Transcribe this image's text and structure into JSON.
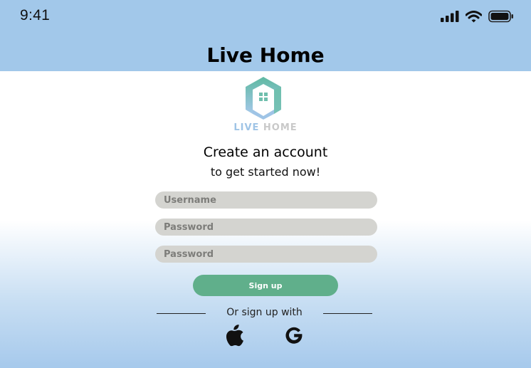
{
  "status_bar": {
    "time": "9:41"
  },
  "header": {
    "title": "Live Home"
  },
  "logo": {
    "text_live": "LIVE",
    "text_home": "HOME"
  },
  "form": {
    "heading": "Create an account",
    "subheading": "to get started now!",
    "username_placeholder": "Username",
    "password_placeholder": "Password",
    "confirm_password_placeholder": "Password",
    "signup_label": "Sign up",
    "alt_signup_text": "Or sign up with"
  },
  "social": {
    "apple_icon": "apple-icon",
    "google_icon": "google-icon"
  },
  "colors": {
    "header_bg": "#a2c8ea",
    "signup_button": "#60af8b",
    "field_bg": "#d4d4d0",
    "logo_teal": "#6fbfad",
    "logo_blue": "#9fc4e6"
  }
}
